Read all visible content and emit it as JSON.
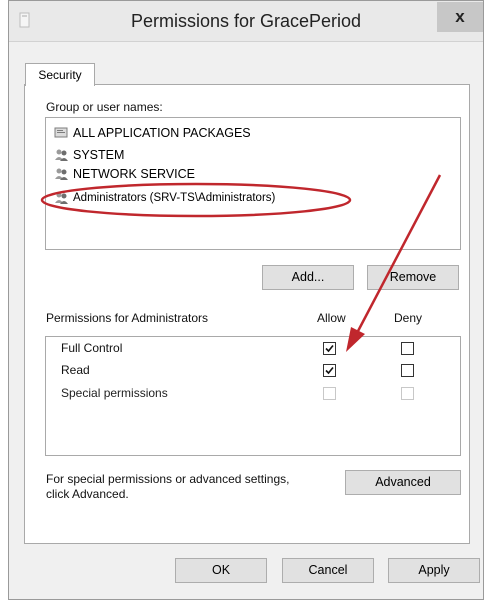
{
  "window": {
    "title": "Permissions for GracePeriod",
    "close_symbol": "x"
  },
  "tabs": [
    {
      "label": "Security"
    }
  ],
  "group_section": {
    "label": "Group or user names:",
    "items": [
      {
        "label": "ALL APPLICATION PACKAGES",
        "icon": "packages-icon"
      },
      {
        "label": "SYSTEM",
        "icon": "users-icon"
      },
      {
        "label": "NETWORK SERVICE",
        "icon": "users-icon"
      },
      {
        "label": "Administrators (SRV-TS\\Administrators)",
        "icon": "users-icon",
        "selected": true
      }
    ],
    "add_label": "Add...",
    "remove_label": "Remove"
  },
  "permissions": {
    "header": "Permissions for Administrators",
    "allow_label": "Allow",
    "deny_label": "Deny",
    "rows": [
      {
        "label": "Full Control",
        "allow": true,
        "deny": false,
        "enabled": true
      },
      {
        "label": "Read",
        "allow": true,
        "deny": false,
        "enabled": true
      },
      {
        "label": "Special permissions",
        "allow": false,
        "deny": false,
        "enabled": false
      }
    ]
  },
  "advanced": {
    "text_line1": "For special permissions or advanced settings,",
    "text_line2": "click Advanced.",
    "button_label": "Advanced"
  },
  "footer": {
    "ok_label": "OK",
    "cancel_label": "Cancel",
    "apply_label": "Apply"
  },
  "annotation": {
    "color": "#c0272d",
    "highlight_target": "Administrators (SRV-TS\\Administrators)",
    "arrow_target": "Full Control allow checkbox"
  }
}
